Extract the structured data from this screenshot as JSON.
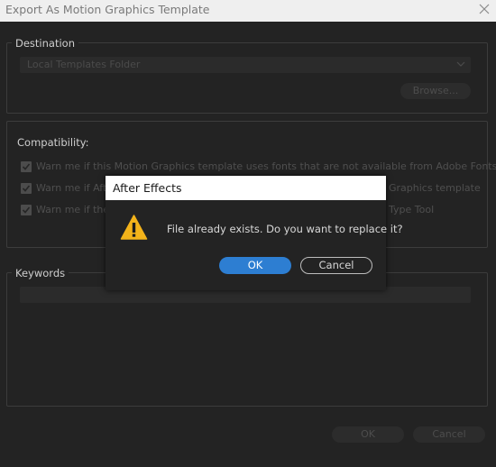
{
  "window": {
    "title": "Export As Motion Graphics Template"
  },
  "destination": {
    "legend": "Destination",
    "folder_value": "Local Templates Folder",
    "browse_label": "Browse..."
  },
  "compatibility": {
    "legend": "Compatibility:",
    "options": [
      {
        "text": "Warn me if this Motion Graphics template uses fonts that are not available from Adobe Fonts",
        "checked": true
      },
      {
        "text": "Warn me if After Effects...",
        "checked": true,
        "visible_left": "Warn me if Afte",
        "visible_right": "Graphics template"
      },
      {
        "text": "Warn me if there...",
        "checked": true,
        "visible_left": "Warn me if ther",
        "visible_right": "Type Tool"
      }
    ]
  },
  "keywords": {
    "legend": "Keywords",
    "value": ""
  },
  "footer": {
    "ok_label": "OK",
    "cancel_label": "Cancel"
  },
  "dialog": {
    "title": "After Effects",
    "icon": "warning-icon",
    "message": "File already exists. Do you want to replace it?",
    "ok_label": "OK",
    "cancel_label": "Cancel"
  },
  "colors": {
    "background": "#232323",
    "accent": "#2d7ed2",
    "warning": "#f3b31a"
  }
}
